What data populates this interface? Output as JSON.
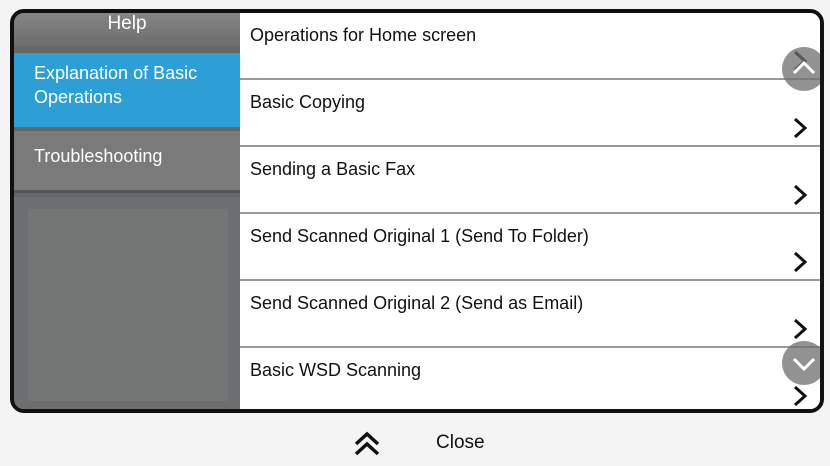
{
  "sidebar": {
    "title": "Help",
    "items": [
      {
        "label": "Explanation of Basic Operations",
        "active": true
      },
      {
        "label": "Troubleshooting",
        "active": false
      }
    ]
  },
  "list": {
    "items": [
      {
        "label": "Operations for Home screen"
      },
      {
        "label": "Basic Copying"
      },
      {
        "label": "Sending a Basic Fax"
      },
      {
        "label": "Send Scanned Original 1 (Send To Folder)"
      },
      {
        "label": "Send Scanned Original 2 (Send as Email)"
      },
      {
        "label": "Basic WSD Scanning"
      }
    ]
  },
  "footer": {
    "close_label": "Close"
  },
  "colors": {
    "accent": "#2b9fd6",
    "sidebar": "#656667",
    "frame": "#101010"
  },
  "icons": {
    "row_chevron": "chevron-right-icon",
    "scroll_up": "scroll-up-icon",
    "scroll_down": "scroll-down-icon",
    "close": "double-chevron-up-icon"
  }
}
